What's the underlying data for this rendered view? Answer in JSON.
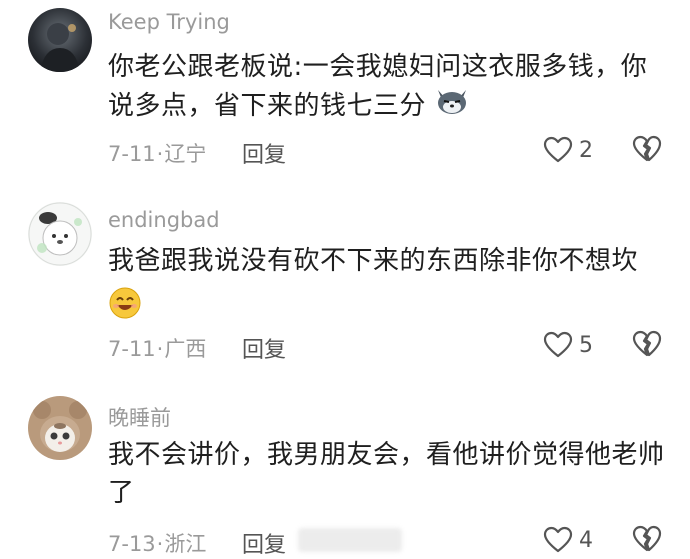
{
  "colors": {
    "text": "#1f1f1f",
    "meta": "#9a9a9a",
    "action": "#555555"
  },
  "comments": [
    {
      "username": "Keep Trying",
      "text": "你老公跟老板说:一会我媳妇问这衣服多钱，你说多点，省下来的钱七三分",
      "emoji": "wolf-emoji",
      "date": "7-11",
      "region": "辽宁",
      "reply_label": "回复",
      "likes": "2",
      "avatar_icon": "avatar-dark-figure"
    },
    {
      "username": "endingbad",
      "text": "我爸跟我说没有砍不下来的东西除非你不想坎",
      "emoji": "smile-emoji",
      "date": "7-11",
      "region": "广西",
      "reply_label": "回复",
      "likes": "5",
      "avatar_icon": "avatar-white-bear"
    },
    {
      "username": "晚睡前",
      "text": "我不会讲价，我男朋友会，看他讲价觉得他老帅了",
      "date": "7-13",
      "region": "浙江",
      "reply_label": "回复",
      "likes": "4",
      "avatar_icon": "avatar-cat-hood"
    }
  ]
}
